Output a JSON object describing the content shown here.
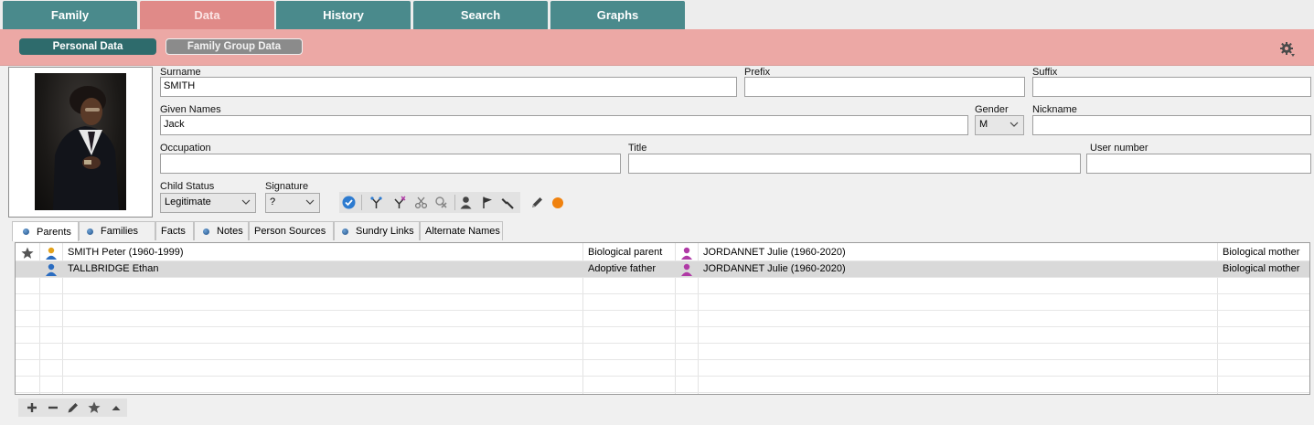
{
  "top_tabs": [
    {
      "label": "Family",
      "active": false
    },
    {
      "label": "Data",
      "active": true
    },
    {
      "label": "History",
      "active": false
    },
    {
      "label": "Search",
      "active": false
    },
    {
      "label": "Graphs",
      "active": false
    }
  ],
  "subheader": {
    "personal_label": "Personal Data",
    "family_group_label": "Family Group Data"
  },
  "form": {
    "surname_label": "Surname",
    "surname": "SMITH",
    "prefix_label": "Prefix",
    "prefix": "",
    "suffix_label": "Suffix",
    "suffix": "",
    "given_label": "Given Names",
    "given": "Jack",
    "gender_label": "Gender",
    "gender": "M",
    "nickname_label": "Nickname",
    "nickname": "",
    "occupation_label": "Occupation",
    "occupation": "",
    "title_label": "Title",
    "title": "",
    "user_number_label": "User number",
    "user_number": "",
    "child_status_label": "Child Status",
    "child_status": "Legitimate",
    "signature_label": "Signature",
    "signature": "?"
  },
  "subtabs": [
    {
      "label": "Parents",
      "dot": true,
      "active": true
    },
    {
      "label": "Families",
      "dot": true,
      "active": false
    },
    {
      "label": "Facts",
      "dot": false,
      "active": false
    },
    {
      "label": "Notes",
      "dot": true,
      "active": false
    },
    {
      "label": "Person Sources",
      "dot": false,
      "active": false
    },
    {
      "label": "Sundry Links",
      "dot": true,
      "active": false
    },
    {
      "label": "Alternate Names",
      "dot": false,
      "active": false
    }
  ],
  "parents": [
    {
      "father": "SMITH Peter (1960-1999)",
      "father_relation": "Biological parent",
      "mother": "JORDANNET Julie (1960-2020)",
      "mother_relation": "Biological mother",
      "starred": true
    },
    {
      "father": "TALLBRIDGE Ethan",
      "father_relation": "Adoptive father",
      "mother": "JORDANNET Julie (1960-2020)",
      "mother_relation": "Biological mother",
      "starred": false
    }
  ],
  "colors": {
    "tab_teal": "#4a8a8c",
    "tab_active_pink": "#e08a88",
    "subbar_pink": "#eca8a5",
    "pill_teal": "#2e6b6c",
    "accent_orange": "#f0820f",
    "check_blue": "#2d7bd0"
  }
}
